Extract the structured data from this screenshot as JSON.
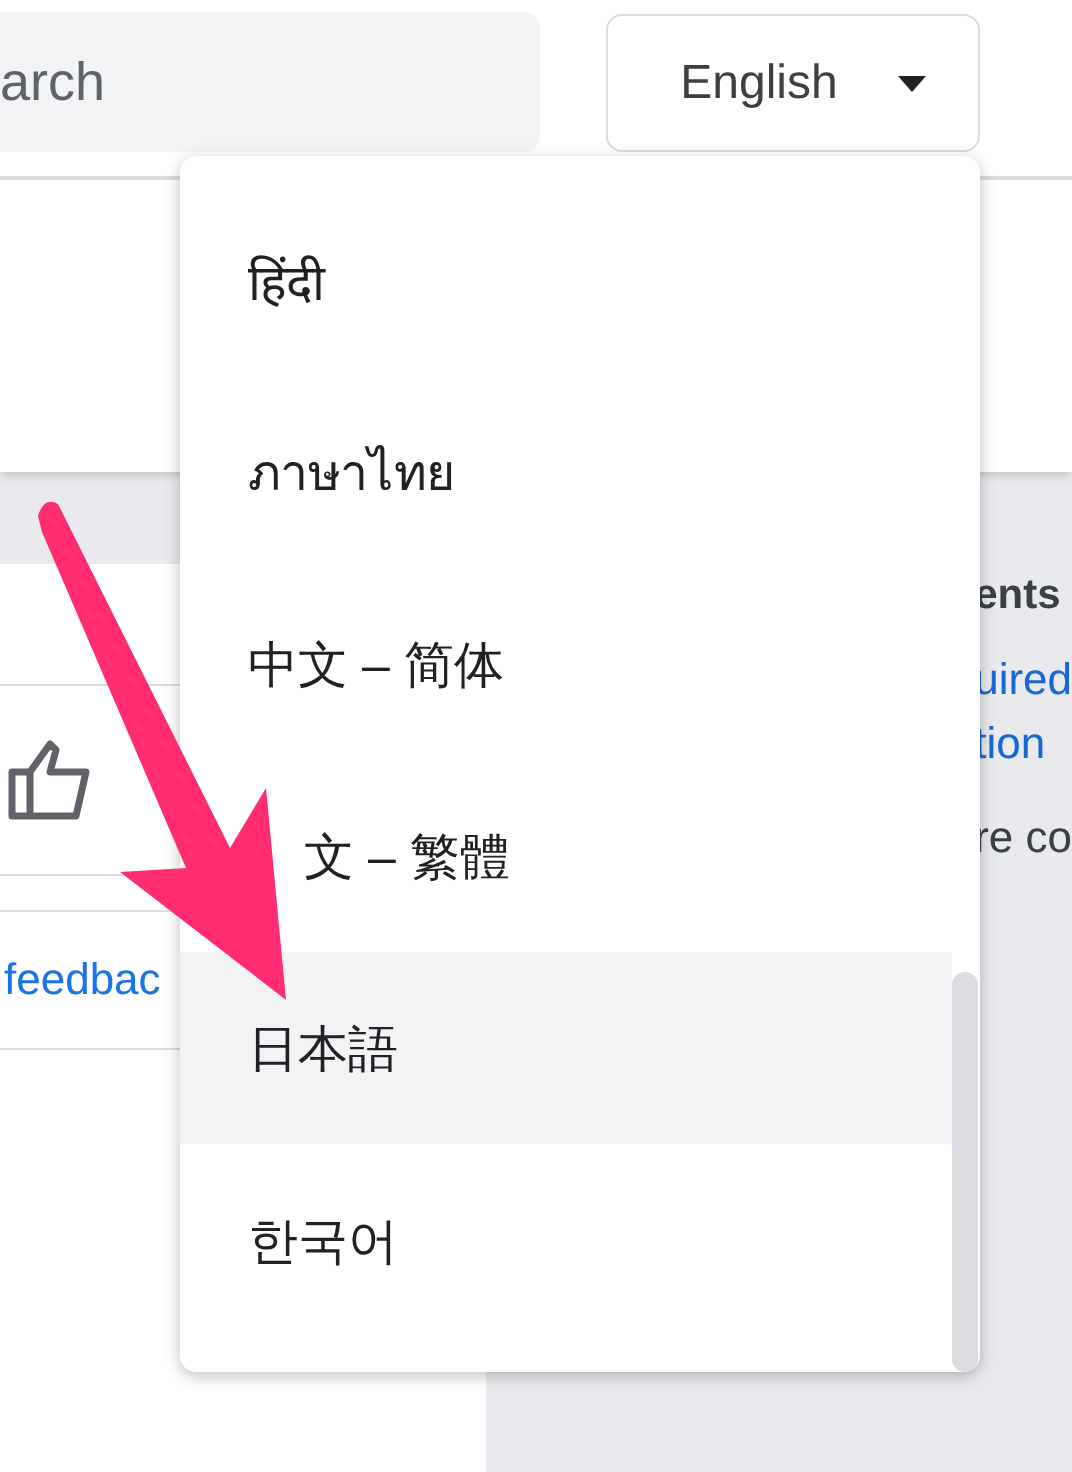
{
  "search": {
    "placeholder": "arch"
  },
  "language_button": {
    "label": "English"
  },
  "language_menu": {
    "items": [
      {
        "label": "हिंदी",
        "selected": false
      },
      {
        "label": "ภาษาไทย",
        "selected": false
      },
      {
        "label": "中文 – 简体",
        "selected": false
      },
      {
        "label": "文 – 繁體",
        "selected": false,
        "kind": "covered"
      },
      {
        "label": "日本語",
        "selected": true
      },
      {
        "label": "한국어",
        "selected": false
      }
    ]
  },
  "left_card": {
    "feedback_link": "feedbac"
  },
  "right_panel": {
    "heading": "ents",
    "link_lines": [
      "uired",
      "tion"
    ],
    "text": "re co"
  }
}
